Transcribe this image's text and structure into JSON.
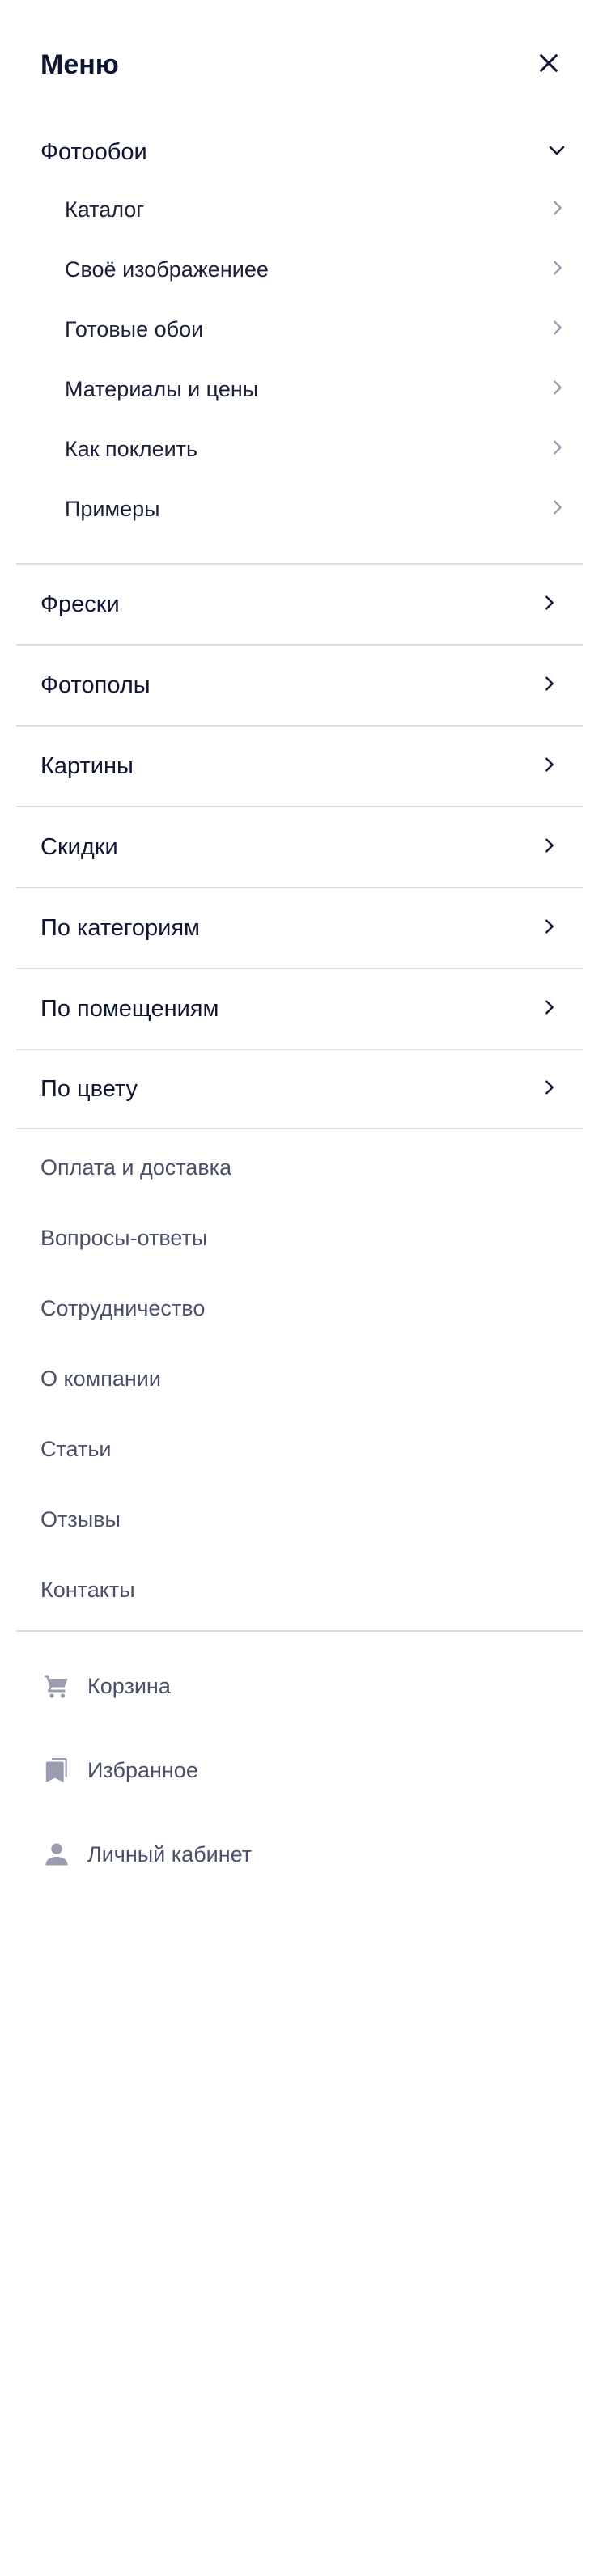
{
  "header": {
    "title": "Меню",
    "close_icon": "close-icon"
  },
  "expanded_section": {
    "title": "Фотообои",
    "items": [
      {
        "label": "Каталог"
      },
      {
        "label": "Своё изображениее"
      },
      {
        "label": "Готовые обои"
      },
      {
        "label": "Материалы и цены"
      },
      {
        "label": "Как поклеить"
      },
      {
        "label": "Примеры"
      }
    ]
  },
  "categories": [
    {
      "label": "Фрески"
    },
    {
      "label": "Фотополы"
    },
    {
      "label": "Картины"
    },
    {
      "label": "Скидки"
    },
    {
      "label": "По категориям"
    },
    {
      "label": "По помещениям"
    },
    {
      "label": "По цвету"
    }
  ],
  "info_links": [
    {
      "label": "Оплата и доставка"
    },
    {
      "label": "Вопросы-ответы"
    },
    {
      "label": "Сотрудничество"
    },
    {
      "label": "О компании"
    },
    {
      "label": "Статьи"
    },
    {
      "label": "Отзывы"
    },
    {
      "label": "Контакты"
    }
  ],
  "account_links": [
    {
      "label": "Корзина",
      "icon": "cart-icon"
    },
    {
      "label": "Избранное",
      "icon": "bookmark-icon"
    },
    {
      "label": "Личный кабинет",
      "icon": "user-icon"
    }
  ],
  "colors": {
    "primary_text": "#0f1633",
    "secondary_text": "#4a4f6a",
    "muted_icon": "#9a9db0",
    "divider": "#dcdde2"
  }
}
